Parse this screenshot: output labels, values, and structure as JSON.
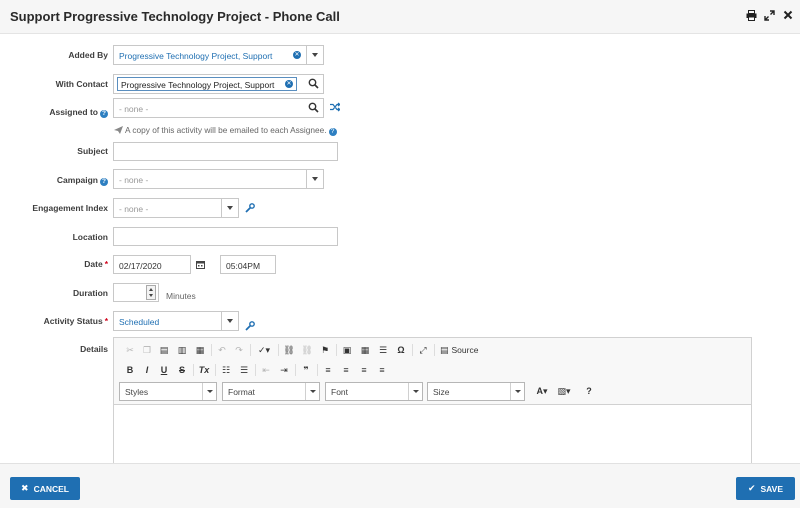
{
  "dialog": {
    "title": "Support Progressive Technology Project - Phone Call"
  },
  "form": {
    "added_by": {
      "label": "Added By",
      "value": "Progressive Technology Project, Support"
    },
    "with_contact": {
      "label": "With Contact",
      "value": "Progressive Technology Project, Support"
    },
    "assigned_to": {
      "label": "Assigned to",
      "placeholder": "- none -",
      "note": "A copy of this activity will be emailed to each Assignee."
    },
    "subject": {
      "label": "Subject",
      "value": ""
    },
    "campaign": {
      "label": "Campaign",
      "value": "- none -"
    },
    "engagement_index": {
      "label": "Engagement Index",
      "value": "- none -"
    },
    "location": {
      "label": "Location",
      "value": ""
    },
    "date": {
      "label": "Date",
      "date_value": "02/17/2020",
      "time_value": "05:04PM"
    },
    "duration": {
      "label": "Duration",
      "value": "",
      "unit": "Minutes"
    },
    "activity_status": {
      "label": "Activity Status",
      "value": "Scheduled"
    },
    "details": {
      "label": "Details",
      "source_label": "Source",
      "combos": {
        "styles": "Styles",
        "format": "Format",
        "font": "Font",
        "size": "Size"
      }
    }
  },
  "footer": {
    "cancel_label": "CANCEL",
    "save_label": "SAVE"
  },
  "colors": {
    "accent": "#1f6fb2",
    "required": "#d0021b"
  }
}
